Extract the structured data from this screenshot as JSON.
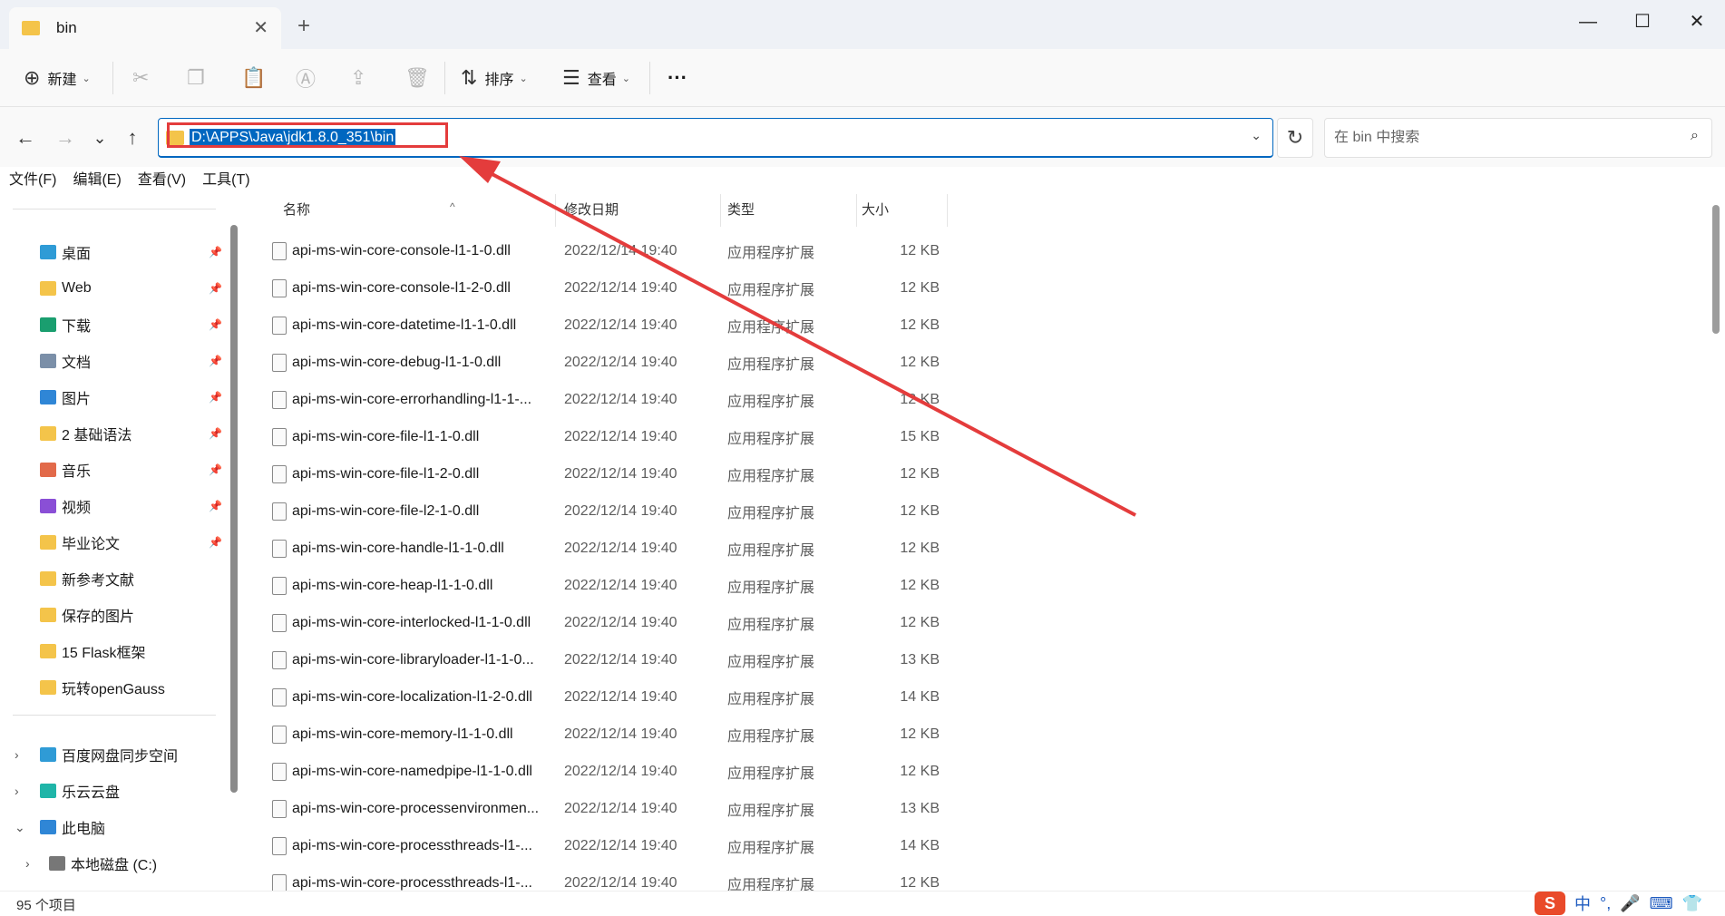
{
  "window": {
    "tab_title": "bin",
    "tab_close_glyph": "✕",
    "new_tab_glyph": "+",
    "minimize_glyph": "—",
    "maximize_glyph": "☐",
    "close_glyph": "✕"
  },
  "toolbar": {
    "new_label": "新建",
    "sort_label": "排序",
    "view_label": "查看",
    "more_glyph": "···",
    "icons": [
      "plus-circle-icon",
      "cut-icon",
      "copy-icon",
      "paste-icon",
      "rename-icon",
      "share-icon",
      "delete-icon",
      "sort-icon",
      "view-icon"
    ]
  },
  "navigation": {
    "back_glyph": "←",
    "forward_glyph": "→",
    "recent_glyph": "⌄",
    "up_glyph": "↑",
    "address_path": "D:\\APPS\\Java\\jdk1.8.0_351\\bin",
    "refresh_glyph": "↻",
    "search_placeholder": "在 bin 中搜索",
    "search_glyph": "⌕"
  },
  "menubar": {
    "items": [
      "文件(F)",
      "编辑(E)",
      "查看(V)",
      "工具(T)"
    ]
  },
  "sidebar": {
    "quick_access": [
      {
        "label": "桌面",
        "icon": "desktop-icon",
        "color": "#2f9bd6",
        "pinned": true
      },
      {
        "label": "Web",
        "icon": "folder-icon",
        "color": "#f4c44a",
        "pinned": true
      },
      {
        "label": "下载",
        "icon": "download-icon",
        "color": "#1a9e6f",
        "pinned": true
      },
      {
        "label": "文档",
        "icon": "document-icon",
        "color": "#7b8fa8",
        "pinned": true
      },
      {
        "label": "图片",
        "icon": "pictures-icon",
        "color": "#2f86d6",
        "pinned": true
      },
      {
        "label": "2 基础语法",
        "icon": "folder-icon",
        "color": "#f4c44a",
        "pinned": true
      },
      {
        "label": "音乐",
        "icon": "music-icon",
        "color": "#e26a4a",
        "pinned": true
      },
      {
        "label": "视频",
        "icon": "video-icon",
        "color": "#8a4fd6",
        "pinned": true
      },
      {
        "label": "毕业论文",
        "icon": "folder-icon",
        "color": "#f4c44a",
        "pinned": true
      },
      {
        "label": "新参考文献",
        "icon": "folder-icon",
        "color": "#f4c44a",
        "pinned": false
      },
      {
        "label": "保存的图片",
        "icon": "folder-icon",
        "color": "#f4c44a",
        "pinned": false
      },
      {
        "label": "15 Flask框架",
        "icon": "folder-icon",
        "color": "#f4c44a",
        "pinned": false
      },
      {
        "label": "玩转openGauss",
        "icon": "folder-icon",
        "color": "#f4c44a",
        "pinned": false
      }
    ],
    "locations": [
      {
        "label": "百度网盘同步空间",
        "icon": "baidu-netdisk-icon",
        "color": "#2f9bd6",
        "chevron": "›"
      },
      {
        "label": "乐云云盘",
        "icon": "cloud-icon",
        "color": "#1fb5a8",
        "chevron": "›"
      },
      {
        "label": "此电脑",
        "icon": "pc-icon",
        "color": "#2f86d6",
        "chevron": "⌄"
      },
      {
        "label": "本地磁盘 (C:)",
        "icon": "drive-icon",
        "color": "#777777",
        "chevron": "›"
      }
    ]
  },
  "columns": {
    "name": "名称",
    "date": "修改日期",
    "type": "类型",
    "size": "大小",
    "sort_glyph": "^"
  },
  "files": [
    {
      "name": "api-ms-win-core-console-l1-1-0.dll",
      "date": "2022/12/14 19:40",
      "type": "应用程序扩展",
      "size": "12 KB"
    },
    {
      "name": "api-ms-win-core-console-l1-2-0.dll",
      "date": "2022/12/14 19:40",
      "type": "应用程序扩展",
      "size": "12 KB"
    },
    {
      "name": "api-ms-win-core-datetime-l1-1-0.dll",
      "date": "2022/12/14 19:40",
      "type": "应用程序扩展",
      "size": "12 KB"
    },
    {
      "name": "api-ms-win-core-debug-l1-1-0.dll",
      "date": "2022/12/14 19:40",
      "type": "应用程序扩展",
      "size": "12 KB"
    },
    {
      "name": "api-ms-win-core-errorhandling-l1-1-...",
      "date": "2022/12/14 19:40",
      "type": "应用程序扩展",
      "size": "12 KB"
    },
    {
      "name": "api-ms-win-core-file-l1-1-0.dll",
      "date": "2022/12/14 19:40",
      "type": "应用程序扩展",
      "size": "15 KB"
    },
    {
      "name": "api-ms-win-core-file-l1-2-0.dll",
      "date": "2022/12/14 19:40",
      "type": "应用程序扩展",
      "size": "12 KB"
    },
    {
      "name": "api-ms-win-core-file-l2-1-0.dll",
      "date": "2022/12/14 19:40",
      "type": "应用程序扩展",
      "size": "12 KB"
    },
    {
      "name": "api-ms-win-core-handle-l1-1-0.dll",
      "date": "2022/12/14 19:40",
      "type": "应用程序扩展",
      "size": "12 KB"
    },
    {
      "name": "api-ms-win-core-heap-l1-1-0.dll",
      "date": "2022/12/14 19:40",
      "type": "应用程序扩展",
      "size": "12 KB"
    },
    {
      "name": "api-ms-win-core-interlocked-l1-1-0.dll",
      "date": "2022/12/14 19:40",
      "type": "应用程序扩展",
      "size": "12 KB"
    },
    {
      "name": "api-ms-win-core-libraryloader-l1-1-0...",
      "date": "2022/12/14 19:40",
      "type": "应用程序扩展",
      "size": "13 KB"
    },
    {
      "name": "api-ms-win-core-localization-l1-2-0.dll",
      "date": "2022/12/14 19:40",
      "type": "应用程序扩展",
      "size": "14 KB"
    },
    {
      "name": "api-ms-win-core-memory-l1-1-0.dll",
      "date": "2022/12/14 19:40",
      "type": "应用程序扩展",
      "size": "12 KB"
    },
    {
      "name": "api-ms-win-core-namedpipe-l1-1-0.dll",
      "date": "2022/12/14 19:40",
      "type": "应用程序扩展",
      "size": "12 KB"
    },
    {
      "name": "api-ms-win-core-processenvironmen...",
      "date": "2022/12/14 19:40",
      "type": "应用程序扩展",
      "size": "13 KB"
    },
    {
      "name": "api-ms-win-core-processthreads-l1-...",
      "date": "2022/12/14 19:40",
      "type": "应用程序扩展",
      "size": "14 KB"
    },
    {
      "name": "api-ms-win-core-processthreads-l1-...",
      "date": "2022/12/14 19:40",
      "type": "应用程序扩展",
      "size": "12 KB"
    }
  ],
  "status": {
    "item_count": "95 个项目"
  },
  "ime": {
    "logo": "S",
    "mode": "中",
    "punct": "°,",
    "mic": "🎤",
    "keyboard": "⌨",
    "shirt": "👕"
  },
  "annotation": {
    "highlight_color": "#e43c3c"
  }
}
